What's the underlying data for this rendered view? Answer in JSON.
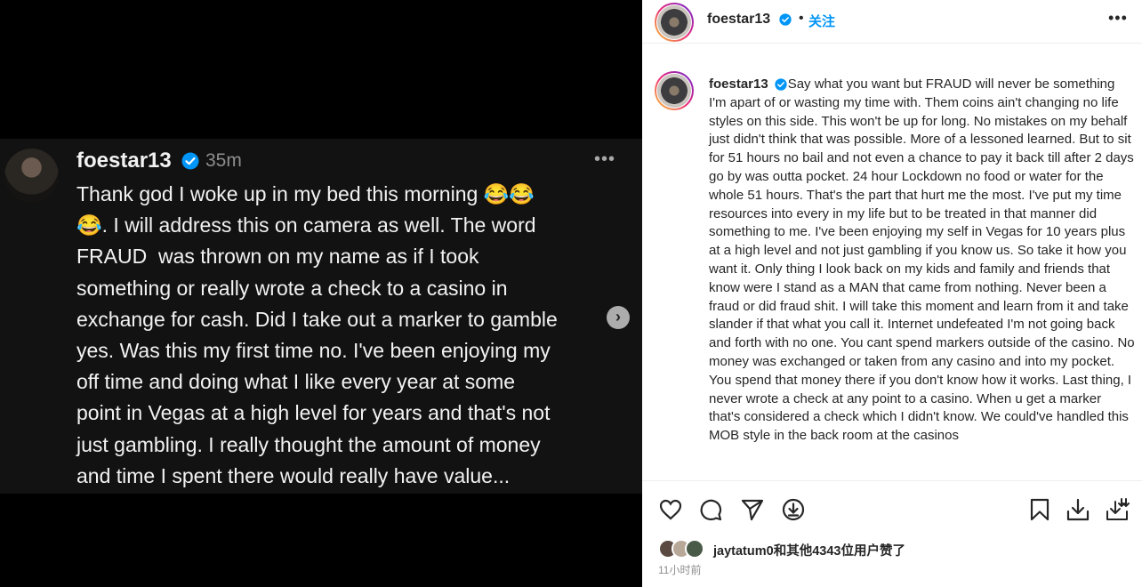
{
  "left_post": {
    "username": "foestar13",
    "time": "35m",
    "more": "•••",
    "body": "Thank god I woke up in my bed this morning 😂😂\n😂. I will address this on camera as well. The word\nFRAUD  was thrown on my name as if I took\nsomething or really wrote a check to a casino in\nexchange for cash. Did I take out a marker to gamble\nyes. Was this my first time no. I've been enjoying my\noff time and doing what I like every year at some\npoint in Vegas at a high level for years and that's not\njust gambling. I really thought the amount of money\nand time I spent there would really have value...",
    "next_arrow": "›"
  },
  "header": {
    "username": "foestar13",
    "separator": "•",
    "follow": "关注",
    "more": "•••"
  },
  "caption": {
    "username": "foestar13",
    "text": "Say what you want but FRAUD will never be something I'm apart of or wasting my time with. Them coins ain't changing no life styles on this side. This won't be up for long. No mistakes on my behalf just didn't think that was possible. More of a lessoned learned. But to sit for 51 hours no bail and not even a chance to pay it back till after 2 days go by was outta pocket. 24 hour Lockdown no food or water for the whole 51 hours. That's the part that hurt me the most. I've put my time resources into every in my life but to be treated in that manner did something to me. I've been enjoying my self in Vegas for 10 years plus at a high level and not just gambling if you know us. So take it how you want it. Only thing I look back on my kids and family and friends that know were I stand as a MAN that came from nothing. Never been a fraud or did fraud shit. I will take this moment and learn from it and take slander if that what you call it. Internet undefeated I'm not going back and forth with no one. You cant spend markers outside of the casino. No money was exchanged or taken from any casino and into my pocket. You spend that money there if you don't know how it works. Last thing, I never wrote a check at any point to a casino. When u get a marker that's considered a check which I didn't know. We could've handled this MOB style in the back room at the casinos"
  },
  "actions": {
    "icons": [
      "heart-icon",
      "comment-icon",
      "share-icon",
      "download-circle-icon",
      "bookmark-icon",
      "download-icon",
      "save-to-device-icon"
    ]
  },
  "likes": {
    "text": "jaytatum0和其他4343位用户赞了"
  },
  "time_ago": "11小时前",
  "colors": {
    "verified": "#0095f6",
    "link": "#0095f6",
    "dark_bg": "#121212"
  }
}
